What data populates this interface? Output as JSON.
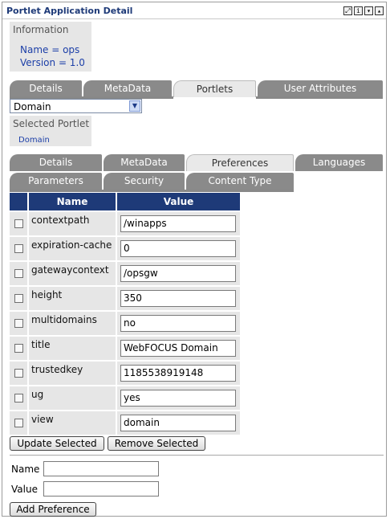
{
  "window": {
    "title": "Portlet Application Detail",
    "controls": [
      "restore-icon",
      "info-icon",
      "minimize-icon",
      "maximize-icon"
    ]
  },
  "information": {
    "heading": "Information",
    "name_line": "Name = ops",
    "version_line": "Version = 1.0"
  },
  "app_tabs": [
    {
      "label": "Details",
      "active": false
    },
    {
      "label": "MetaData",
      "active": false
    },
    {
      "label": "Portlets",
      "active": true
    },
    {
      "label": "User Attributes",
      "active": false
    }
  ],
  "portlet_select": {
    "selected": "Domain"
  },
  "selected_portlet": {
    "heading": "Selected Portlet",
    "value": "Domain"
  },
  "portlet_tabs_row1": [
    {
      "label": "Details",
      "active": false
    },
    {
      "label": "MetaData",
      "active": false
    },
    {
      "label": "Preferences",
      "active": true
    },
    {
      "label": "Languages",
      "active": false
    }
  ],
  "portlet_tabs_row2": [
    {
      "label": "Parameters",
      "active": false
    },
    {
      "label": "Security",
      "active": false
    },
    {
      "label": "Content Type",
      "active": false
    }
  ],
  "table": {
    "columns": [
      "Name",
      "Value"
    ],
    "rows": [
      {
        "name": "contextpath",
        "value": "/winapps"
      },
      {
        "name": "expiration-cache",
        "value": "0"
      },
      {
        "name": "gatewaycontext",
        "value": "/opsgw"
      },
      {
        "name": "height",
        "value": "350"
      },
      {
        "name": "multidomains",
        "value": "no"
      },
      {
        "name": "title",
        "value": "WebFOCUS Domain"
      },
      {
        "name": "trustedkey",
        "value": "1185538919148"
      },
      {
        "name": "ug",
        "value": "yes"
      },
      {
        "name": "view",
        "value": "domain"
      }
    ]
  },
  "buttons": {
    "update": "Update Selected",
    "remove": "Remove Selected",
    "add": "Add Preference"
  },
  "new_pref": {
    "name_label": "Name",
    "value_label": "Value",
    "name_value": "",
    "value_value": ""
  },
  "colors": {
    "header_bg": "#1e3a78",
    "link_blue": "#1c3fa8",
    "tab_inactive": "#8a8a8a",
    "tab_active": "#e9e9e9"
  }
}
